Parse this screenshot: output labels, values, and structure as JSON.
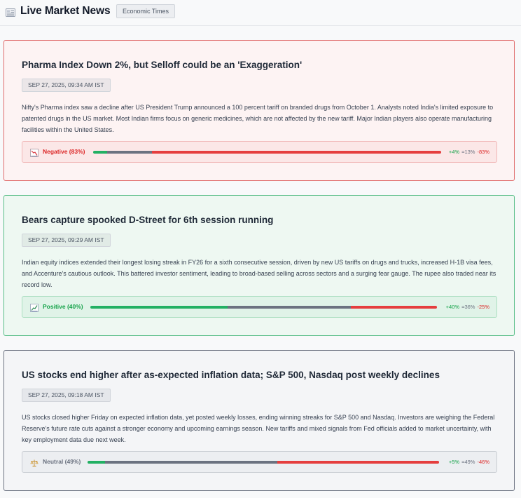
{
  "header": {
    "title": "Live Market News",
    "source": "Economic Times",
    "icon": "newspaper-icon"
  },
  "colors": {
    "positive": "#22b063",
    "neutral": "#6b7280",
    "negative": "#e53e3e"
  },
  "articles": [
    {
      "title": "Pharma Index Down 2%, but Selloff could be an 'Exaggeration'",
      "timestamp": "SEP 27, 2025, 09:34 AM IST",
      "summary": "Nifty's Pharma index saw a decline after US President Trump announced a 100 percent tariff on branded drugs from October 1. Analysts noted India's limited exposure to patented drugs in the US market. Most Indian firms focus on generic medicines, which are not affected by the new tariff. Major Indian players also operate manufacturing facilities within the United States.",
      "sentiment": {
        "label": "Negative (83%)",
        "icon": "chart-down-icon",
        "positive": 4,
        "neutral": 13,
        "negative": 83,
        "positive_text": "+4%",
        "neutral_text": "=13%",
        "negative_text": "-83%"
      }
    },
    {
      "title": "Bears capture spooked D-Street for 6th session running",
      "timestamp": "SEP 27, 2025, 09:29 AM IST",
      "summary": "Indian equity indices extended their longest losing streak in FY26 for a sixth consecutive session, driven by new US tariffs on drugs and trucks, increased H-1B visa fees, and Accenture's cautious outlook. This battered investor sentiment, leading to broad-based selling across sectors and a surging fear gauge. The rupee also traded near its record low.",
      "sentiment": {
        "label": "Positive (40%)",
        "icon": "chart-up-icon",
        "positive": 40,
        "neutral": 36,
        "negative": 25,
        "positive_text": "+40%",
        "neutral_text": "=36%",
        "negative_text": "-25%"
      }
    },
    {
      "title": "US stocks end higher after as-expected inflation data; S&P 500, Nasdaq post weekly declines",
      "timestamp": "SEP 27, 2025, 09:18 AM IST",
      "summary": "US stocks closed higher Friday on expected inflation data, yet posted weekly losses, ending winning streaks for S&P 500 and Nasdaq. Investors are weighing the Federal Reserve's future rate cuts against a stronger economy and upcoming earnings season. New tariffs and mixed signals from Fed officials added to market uncertainty, with key employment data due next week.",
      "sentiment": {
        "label": "Neutral (49%)",
        "icon": "scale-icon",
        "positive": 5,
        "neutral": 49,
        "negative": 46,
        "positive_text": "+5%",
        "neutral_text": "=49%",
        "negative_text": "-46%"
      }
    }
  ]
}
